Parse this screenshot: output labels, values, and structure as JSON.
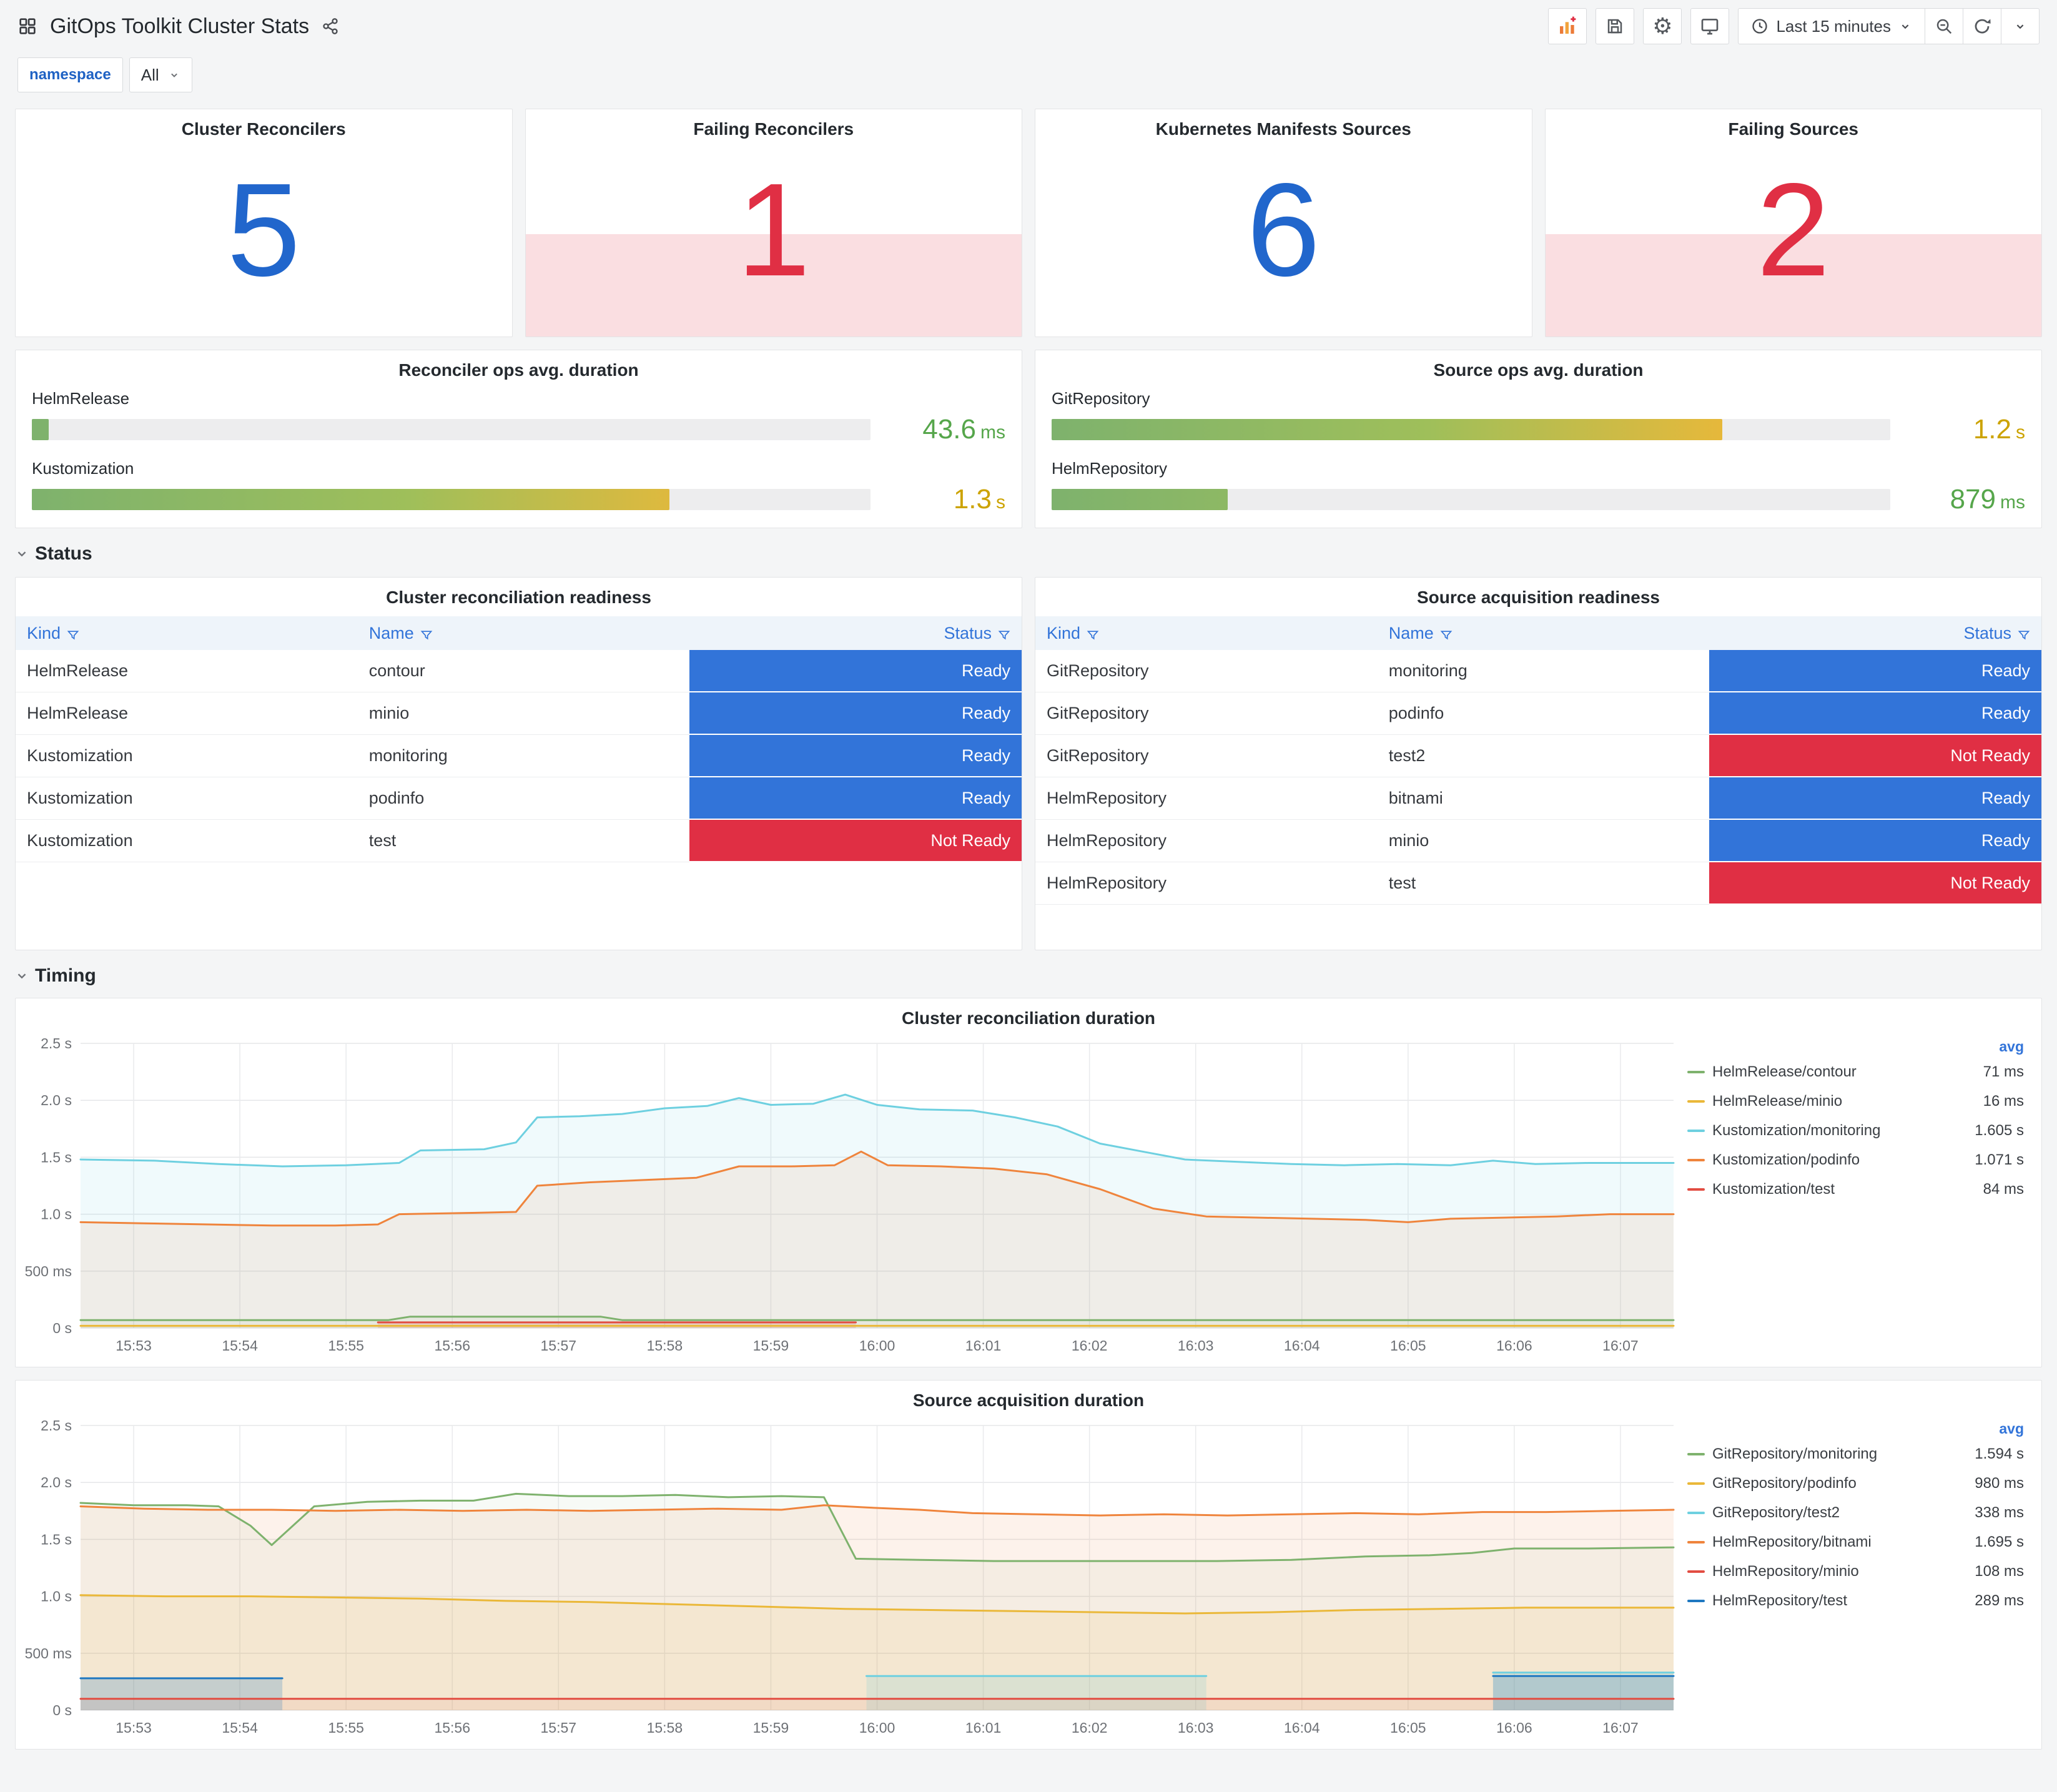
{
  "header": {
    "title": "GitOps Toolkit Cluster Stats",
    "time_range_label": "Last 15 minutes"
  },
  "variables": {
    "label": "namespace",
    "value": "All"
  },
  "sections": {
    "status": "Status",
    "timing": "Timing"
  },
  "colors": {
    "stat_blue": "#2166cc",
    "stat_red": "#e02f44",
    "ready": "#3274d9",
    "not_ready": "#e02f44",
    "link_blue": "#3274d9",
    "value_green": "#56a64b",
    "value_amber": "#cca300"
  },
  "stats": [
    {
      "title": "Cluster Reconcilers",
      "value": "5",
      "alert": false
    },
    {
      "title": "Failing Reconcilers",
      "value": "1",
      "alert": true
    },
    {
      "title": "Kubernetes Manifests Sources",
      "value": "6",
      "alert": false
    },
    {
      "title": "Failing Sources",
      "value": "2",
      "alert": true
    }
  ],
  "gauges": [
    {
      "title": "Reconciler ops avg. duration",
      "rows": [
        {
          "label": "HelmRelease",
          "value": "43.6",
          "unit": "ms",
          "pct": 2,
          "value_color": "#56a64b"
        },
        {
          "label": "Kustomization",
          "value": "1.3",
          "unit": "s",
          "pct": 76,
          "value_color": "#cca300"
        }
      ]
    },
    {
      "title": "Source ops avg. duration",
      "rows": [
        {
          "label": "GitRepository",
          "value": "1.2",
          "unit": "s",
          "pct": 80,
          "value_color": "#cca300"
        },
        {
          "label": "HelmRepository",
          "value": "879",
          "unit": "ms",
          "pct": 21,
          "value_color": "#56a64b"
        }
      ]
    }
  ],
  "tables": [
    {
      "title": "Cluster reconciliation readiness",
      "columns": [
        "Kind",
        "Name",
        "Status"
      ],
      "rows": [
        {
          "kind": "HelmRelease",
          "name": "contour",
          "status": "Ready"
        },
        {
          "kind": "HelmRelease",
          "name": "minio",
          "status": "Ready"
        },
        {
          "kind": "Kustomization",
          "name": "monitoring",
          "status": "Ready"
        },
        {
          "kind": "Kustomization",
          "name": "podinfo",
          "status": "Ready"
        },
        {
          "kind": "Kustomization",
          "name": "test",
          "status": "Not Ready"
        }
      ]
    },
    {
      "title": "Source acquisition readiness",
      "columns": [
        "Kind",
        "Name",
        "Status"
      ],
      "rows": [
        {
          "kind": "GitRepository",
          "name": "monitoring",
          "status": "Ready"
        },
        {
          "kind": "GitRepository",
          "name": "podinfo",
          "status": "Ready"
        },
        {
          "kind": "GitRepository",
          "name": "test2",
          "status": "Not Ready"
        },
        {
          "kind": "HelmRepository",
          "name": "bitnami",
          "status": "Ready"
        },
        {
          "kind": "HelmRepository",
          "name": "minio",
          "status": "Ready"
        },
        {
          "kind": "HelmRepository",
          "name": "test",
          "status": "Not Ready"
        }
      ]
    }
  ],
  "chart_data": [
    {
      "type": "area",
      "title": "Cluster reconciliation duration",
      "legend_header": "avg",
      "xlim": [
        0,
        15
      ],
      "ylim": [
        0,
        2.5
      ],
      "x_ticks": [
        "15:53",
        "15:54",
        "15:55",
        "15:56",
        "15:57",
        "15:58",
        "15:59",
        "16:00",
        "16:01",
        "16:02",
        "16:03",
        "16:04",
        "16:05",
        "16:06",
        "16:07"
      ],
      "y_ticks": [
        0,
        0.5,
        1.0,
        1.5,
        2.0,
        2.5
      ],
      "y_tick_labels": [
        "0 s",
        "500 ms",
        "1.0 s",
        "1.5 s",
        "2.0 s",
        "2.5 s"
      ],
      "series": [
        {
          "name": "HelmRelease/contour",
          "avg": "71 ms",
          "color": "#7EB26D",
          "fill": 0.08,
          "paths": [
            [
              [
                0,
                0.07
              ],
              [
                2.9,
                0.07
              ],
              [
                3.1,
                0.1
              ],
              [
                4.9,
                0.1
              ],
              [
                5.1,
                0.07
              ],
              [
                15,
                0.07
              ]
            ]
          ]
        },
        {
          "name": "HelmRelease/minio",
          "avg": "16 ms",
          "color": "#EAB839",
          "fill": 0.05,
          "paths": [
            [
              [
                0,
                0.02
              ],
              [
                15,
                0.02
              ]
            ]
          ]
        },
        {
          "name": "Kustomization/monitoring",
          "avg": "1.605 s",
          "color": "#6ED0E0",
          "fill": 0.1,
          "paths": [
            [
              [
                0,
                1.48
              ],
              [
                0.7,
                1.47
              ],
              [
                1.3,
                1.44
              ],
              [
                1.9,
                1.42
              ],
              [
                2.5,
                1.43
              ],
              [
                3.0,
                1.45
              ],
              [
                3.2,
                1.56
              ],
              [
                3.8,
                1.57
              ],
              [
                4.1,
                1.63
              ],
              [
                4.3,
                1.85
              ],
              [
                4.7,
                1.86
              ],
              [
                5.1,
                1.88
              ],
              [
                5.5,
                1.93
              ],
              [
                5.9,
                1.95
              ],
              [
                6.2,
                2.02
              ],
              [
                6.5,
                1.96
              ],
              [
                6.9,
                1.97
              ],
              [
                7.2,
                2.05
              ],
              [
                7.5,
                1.96
              ],
              [
                7.9,
                1.92
              ],
              [
                8.4,
                1.91
              ],
              [
                8.8,
                1.85
              ],
              [
                9.2,
                1.77
              ],
              [
                9.6,
                1.62
              ],
              [
                10.0,
                1.55
              ],
              [
                10.4,
                1.48
              ],
              [
                10.9,
                1.46
              ],
              [
                11.4,
                1.44
              ],
              [
                11.9,
                1.43
              ],
              [
                12.4,
                1.44
              ],
              [
                12.9,
                1.43
              ],
              [
                13.3,
                1.47
              ],
              [
                13.7,
                1.44
              ],
              [
                14.2,
                1.45
              ],
              [
                15,
                1.45
              ]
            ]
          ]
        },
        {
          "name": "Kustomization/podinfo",
          "avg": "1.071 s",
          "color": "#EF843C",
          "fill": 0.1,
          "paths": [
            [
              [
                0,
                0.93
              ],
              [
                0.6,
                0.92
              ],
              [
                1.2,
                0.91
              ],
              [
                1.8,
                0.9
              ],
              [
                2.4,
                0.9
              ],
              [
                2.8,
                0.91
              ],
              [
                3.0,
                1.0
              ],
              [
                3.6,
                1.01
              ],
              [
                4.1,
                1.02
              ],
              [
                4.3,
                1.25
              ],
              [
                4.8,
                1.28
              ],
              [
                5.3,
                1.3
              ],
              [
                5.8,
                1.32
              ],
              [
                6.2,
                1.42
              ],
              [
                6.7,
                1.42
              ],
              [
                7.1,
                1.43
              ],
              [
                7.35,
                1.55
              ],
              [
                7.6,
                1.43
              ],
              [
                8.1,
                1.42
              ],
              [
                8.6,
                1.4
              ],
              [
                9.1,
                1.35
              ],
              [
                9.6,
                1.22
              ],
              [
                10.1,
                1.05
              ],
              [
                10.6,
                0.98
              ],
              [
                11.1,
                0.97
              ],
              [
                11.6,
                0.96
              ],
              [
                12.1,
                0.95
              ],
              [
                12.5,
                0.93
              ],
              [
                12.9,
                0.96
              ],
              [
                13.4,
                0.97
              ],
              [
                13.9,
                0.98
              ],
              [
                14.4,
                1.0
              ],
              [
                15,
                1.0
              ]
            ]
          ]
        },
        {
          "name": "Kustomization/test",
          "avg": "84 ms",
          "color": "#E24D42",
          "fill": 0.15,
          "paths": [
            [
              [
                2.8,
                0.05
              ],
              [
                7.3,
                0.05
              ]
            ]
          ]
        }
      ]
    },
    {
      "type": "area",
      "title": "Source acquisition duration",
      "legend_header": "avg",
      "xlim": [
        0,
        15
      ],
      "ylim": [
        0,
        2.5
      ],
      "x_ticks": [
        "15:53",
        "15:54",
        "15:55",
        "15:56",
        "15:57",
        "15:58",
        "15:59",
        "16:00",
        "16:01",
        "16:02",
        "16:03",
        "16:04",
        "16:05",
        "16:06",
        "16:07"
      ],
      "y_ticks": [
        0,
        0.5,
        1.0,
        1.5,
        2.0,
        2.5
      ],
      "y_tick_labels": [
        "0 s",
        "500 ms",
        "1.0 s",
        "1.5 s",
        "2.0 s",
        "2.5 s"
      ],
      "series": [
        {
          "name": "GitRepository/monitoring",
          "avg": "1.594 s",
          "color": "#7EB26D",
          "fill": 0.06,
          "paths": [
            [
              [
                0,
                1.82
              ],
              [
                0.5,
                1.8
              ],
              [
                1.0,
                1.8
              ],
              [
                1.3,
                1.79
              ],
              [
                1.6,
                1.62
              ],
              [
                1.8,
                1.45
              ],
              [
                2.0,
                1.62
              ],
              [
                2.2,
                1.79
              ],
              [
                2.7,
                1.83
              ],
              [
                3.2,
                1.84
              ],
              [
                3.7,
                1.84
              ],
              [
                4.1,
                1.9
              ],
              [
                4.6,
                1.88
              ],
              [
                5.1,
                1.88
              ],
              [
                5.6,
                1.89
              ],
              [
                6.1,
                1.87
              ],
              [
                6.6,
                1.88
              ],
              [
                7.0,
                1.87
              ],
              [
                7.15,
                1.6
              ],
              [
                7.3,
                1.33
              ],
              [
                7.9,
                1.32
              ],
              [
                8.6,
                1.31
              ],
              [
                9.3,
                1.31
              ],
              [
                10.0,
                1.31
              ],
              [
                10.7,
                1.31
              ],
              [
                11.4,
                1.32
              ],
              [
                12.1,
                1.35
              ],
              [
                12.7,
                1.36
              ],
              [
                13.1,
                1.38
              ],
              [
                13.5,
                1.42
              ],
              [
                14.2,
                1.42
              ],
              [
                15,
                1.43
              ]
            ]
          ]
        },
        {
          "name": "GitRepository/podinfo",
          "avg": "980 ms",
          "color": "#EAB839",
          "fill": 0.1,
          "paths": [
            [
              [
                0,
                1.01
              ],
              [
                0.8,
                1.0
              ],
              [
                1.6,
                1.0
              ],
              [
                2.4,
                0.99
              ],
              [
                3.2,
                0.98
              ],
              [
                4.0,
                0.96
              ],
              [
                4.8,
                0.95
              ],
              [
                5.6,
                0.93
              ],
              [
                6.4,
                0.91
              ],
              [
                7.2,
                0.89
              ],
              [
                8.0,
                0.88
              ],
              [
                8.8,
                0.87
              ],
              [
                9.6,
                0.86
              ],
              [
                10.4,
                0.85
              ],
              [
                11.2,
                0.86
              ],
              [
                12.0,
                0.88
              ],
              [
                12.8,
                0.89
              ],
              [
                13.6,
                0.9
              ],
              [
                14.4,
                0.9
              ],
              [
                15,
                0.9
              ]
            ]
          ]
        },
        {
          "name": "GitRepository/test2",
          "avg": "338 ms",
          "color": "#6ED0E0",
          "fill": 0.2,
          "paths": [
            [
              [
                7.4,
                0.3
              ],
              [
                10.6,
                0.3
              ]
            ],
            [
              [
                13.3,
                0.33
              ],
              [
                15,
                0.33
              ]
            ]
          ]
        },
        {
          "name": "HelmRepository/bitnami",
          "avg": "1.695 s",
          "color": "#EF843C",
          "fill": 0.1,
          "paths": [
            [
              [
                0,
                1.79
              ],
              [
                0.6,
                1.77
              ],
              [
                1.2,
                1.76
              ],
              [
                1.8,
                1.76
              ],
              [
                2.4,
                1.75
              ],
              [
                3.0,
                1.76
              ],
              [
                3.6,
                1.75
              ],
              [
                4.2,
                1.76
              ],
              [
                4.8,
                1.75
              ],
              [
                5.4,
                1.76
              ],
              [
                6.0,
                1.77
              ],
              [
                6.6,
                1.76
              ],
              [
                7.0,
                1.8
              ],
              [
                7.4,
                1.78
              ],
              [
                7.9,
                1.76
              ],
              [
                8.4,
                1.73
              ],
              [
                9.0,
                1.72
              ],
              [
                9.6,
                1.71
              ],
              [
                10.2,
                1.72
              ],
              [
                10.8,
                1.71
              ],
              [
                11.4,
                1.72
              ],
              [
                12.0,
                1.73
              ],
              [
                12.6,
                1.72
              ],
              [
                13.2,
                1.74
              ],
              [
                13.8,
                1.74
              ],
              [
                14.4,
                1.75
              ],
              [
                15,
                1.76
              ]
            ]
          ]
        },
        {
          "name": "HelmRepository/minio",
          "avg": "108 ms",
          "color": "#E24D42",
          "fill": 0.08,
          "paths": [
            [
              [
                0,
                0.1
              ],
              [
                15,
                0.1
              ]
            ]
          ]
        },
        {
          "name": "HelmRepository/test",
          "avg": "289 ms",
          "color": "#1F78C1",
          "fill": 0.22,
          "paths": [
            [
              [
                0,
                0.28
              ],
              [
                1.9,
                0.28
              ]
            ],
            [
              [
                13.3,
                0.3
              ],
              [
                15,
                0.3
              ]
            ]
          ]
        }
      ]
    }
  ]
}
